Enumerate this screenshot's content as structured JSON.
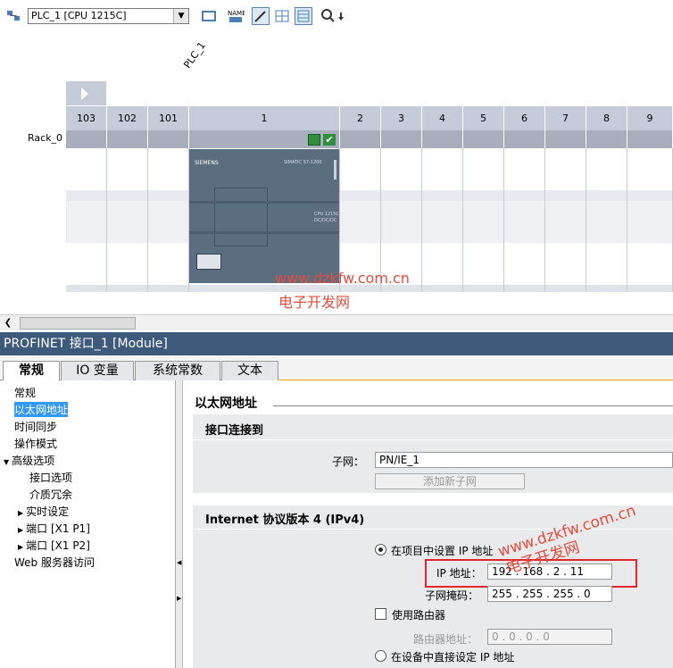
{
  "toolbar": {
    "device_select": "PLC_1 [CPU 1215C]"
  },
  "rack": {
    "plc_label": "PLC_1",
    "rack_label": "Rack_0",
    "slots": [
      "103",
      "102",
      "101",
      "1",
      "2",
      "3",
      "4",
      "5",
      "6",
      "7",
      "8",
      "9"
    ]
  },
  "cpu_module": {
    "brand": "SIEMENS",
    "model_text": "SIMATIC S7-1200",
    "cpu_text": "CPU 1215C",
    "cpu_sub": "DC/DC/DC"
  },
  "watermark": {
    "site": "www.dzkfw.com.cn",
    "name": "电子开发网"
  },
  "panel": {
    "title": "PROFINET 接口_1 [Module]",
    "tabs": [
      "常规",
      "IO 变量",
      "系统常数",
      "文本"
    ]
  },
  "nav": {
    "items": [
      "常规",
      "以太网地址",
      "时间同步",
      "操作模式",
      "高级选项",
      "接口选项",
      "介质冗余",
      "实时设定",
      "端口 [X1 P1]",
      "端口 [X1 P2]",
      "Web 服务器访问"
    ]
  },
  "content": {
    "section_title": "以太网地址",
    "interface_connect": "接口连接到",
    "subnet_label": "子网：",
    "subnet_value": "PN/IE_1",
    "add_subnet": "添加新子网",
    "ipv4_title": "Internet 协议版本 4 (IPv4)",
    "radio_project": "在项目中设置 IP 地址",
    "ip_label": "IP 地址：",
    "ip_value": "192 . 168 . 2   . 11",
    "mask_label": "子网掩码：",
    "mask_value": "255 . 255 . 255 . 0",
    "use_router": "使用路由器",
    "router_label": "路由器地址：",
    "router_value": "0   . 0   . 0   . 0",
    "radio_device": "在设备中直接设定 IP 地址"
  },
  "colors": {
    "panel_title_bg": "#3d5a7a",
    "highlight": "#e0252b",
    "watermark": "#e84b3c",
    "selection": "#3399ff"
  }
}
